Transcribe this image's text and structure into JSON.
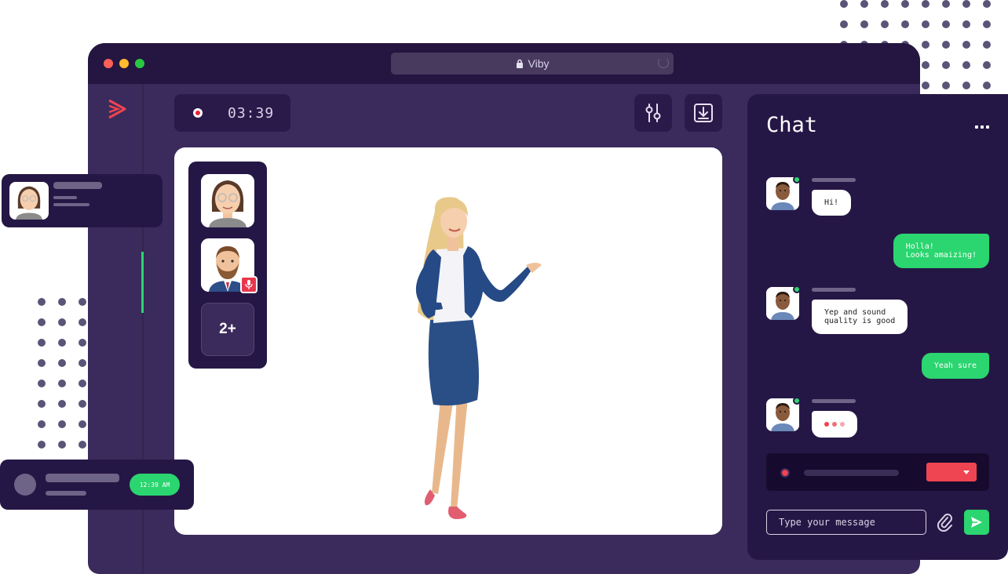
{
  "window": {
    "title": "Viby",
    "lock_icon": "lock-icon",
    "traffic_colors": [
      "#ff5f57",
      "#febc2e",
      "#28c840"
    ]
  },
  "call": {
    "timer": "03:39",
    "more_participants": "2+"
  },
  "toolbar": {
    "settings_icon": "sliders-icon",
    "download_icon": "download-icon"
  },
  "chat": {
    "title": "Chat",
    "messages": [
      {
        "from": "other",
        "text": "Hi!"
      },
      {
        "from": "me",
        "text": "Holla!\nLooks amaizing!"
      },
      {
        "from": "other",
        "text": "Yep and sound\nquality is good"
      },
      {
        "from": "me",
        "text": "Yeah sure"
      },
      {
        "from": "other",
        "typing": true
      }
    ],
    "input_placeholder": "Type your message",
    "attach_icon": "paperclip-icon",
    "send_icon": "send-icon"
  },
  "notification": {
    "time": "12:39 AM"
  },
  "colors": {
    "accent_green": "#2bd56f",
    "accent_red": "#ef4451",
    "dark_purple": "#251745",
    "window_purple": "#3b2b5c"
  }
}
